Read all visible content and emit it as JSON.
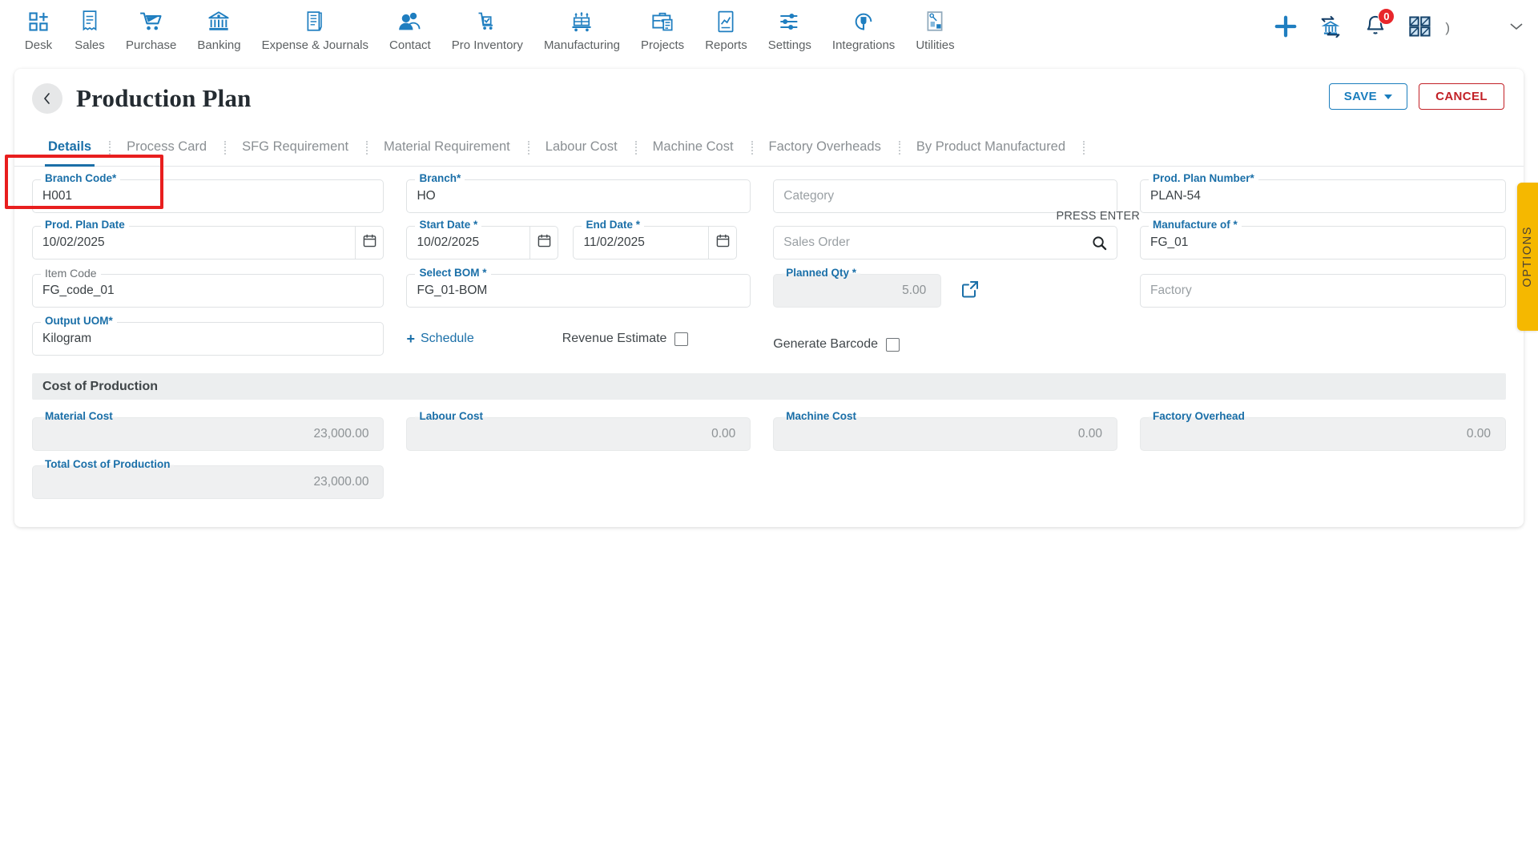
{
  "topnav": {
    "items": [
      {
        "label": "Desk",
        "icon": "desk-grid-plus-icon"
      },
      {
        "label": "Sales",
        "icon": "receipt-icon"
      },
      {
        "label": "Purchase",
        "icon": "shopping-cart-icon"
      },
      {
        "label": "Banking",
        "icon": "bank-icon"
      },
      {
        "label": "Expense & Journals",
        "icon": "notebook-pen-icon"
      },
      {
        "label": "Contact",
        "icon": "people-icon"
      },
      {
        "label": "Pro Inventory",
        "icon": "inventory-cart-icon"
      },
      {
        "label": "Manufacturing",
        "icon": "factory-pallet-icon"
      },
      {
        "label": "Projects",
        "icon": "briefcase-doc-icon"
      },
      {
        "label": "Reports",
        "icon": "report-chart-icon"
      },
      {
        "label": "Settings",
        "icon": "sliders-icon"
      },
      {
        "label": "Integrations",
        "icon": "plug-circle-icon"
      },
      {
        "label": "Utilities",
        "icon": "utilities-page-icon"
      }
    ],
    "right": {
      "add_icon": "plus-icon",
      "bank_transfer_icon": "bank-transfer-icon",
      "notifications_icon": "bell-icon",
      "notifications_count": "0",
      "apps_icon": "grid-apps-icon",
      "paren": ")",
      "expand_icon": "chevron-down-icon"
    }
  },
  "header": {
    "back_icon": "chevron-left-icon",
    "title": "Production Plan",
    "save_label": "SAVE",
    "cancel_label": "CANCEL"
  },
  "tabs": [
    {
      "label": "Details",
      "active": true
    },
    {
      "label": "Process Card",
      "active": false
    },
    {
      "label": "SFG Requirement",
      "active": false
    },
    {
      "label": "Material Requirement",
      "active": false
    },
    {
      "label": "Labour Cost",
      "active": false
    },
    {
      "label": "Machine Cost",
      "active": false
    },
    {
      "label": "Factory Overheads",
      "active": false
    },
    {
      "label": "By Product Manufactured",
      "active": false
    }
  ],
  "form": {
    "branch_code": {
      "label": "Branch Code",
      "required": "*",
      "value": "H001"
    },
    "branch": {
      "label": "Branch",
      "required": "*",
      "value": "HO"
    },
    "category": {
      "placeholder": "Category",
      "value": ""
    },
    "prod_plan_number": {
      "label": "Prod. Plan Number",
      "required": "*",
      "value": "PLAN-54"
    },
    "prod_plan_date": {
      "label": "Prod. Plan Date",
      "required": "",
      "value": "10/02/2025",
      "icon": "calendar-icon"
    },
    "start_date": {
      "label": "Start Date",
      "required": "*",
      "value": "10/02/2025",
      "icon": "calendar-icon"
    },
    "end_date": {
      "label": "End Date",
      "required": "*",
      "value": "11/02/2025",
      "icon": "calendar-icon"
    },
    "sales_order": {
      "placeholder": "Sales Order",
      "value": "",
      "hint": "PRESS ENTER",
      "icon": "search-icon"
    },
    "manufacture_of": {
      "label": "Manufacture of",
      "required": "*",
      "value": "FG_01"
    },
    "item_code": {
      "label": "Item Code",
      "required": "",
      "value": "FG_code_01",
      "highlighted": true
    },
    "select_bom": {
      "label": "Select BOM",
      "required": "*",
      "value": "FG_01-BOM"
    },
    "planned_qty": {
      "label": "Planned Qty",
      "required": "*",
      "value": "5.00",
      "disabled": true,
      "action_icon": "external-link-icon"
    },
    "factory": {
      "placeholder": "Factory",
      "value": ""
    },
    "output_uom": {
      "label": "Output UOM",
      "required": "*",
      "value": "Kilogram"
    },
    "schedule_link": {
      "label": "Schedule",
      "icon": "plus-icon"
    },
    "revenue_estimate": {
      "label": "Revenue Estimate",
      "checked": false
    },
    "generate_barcode": {
      "label": "Generate Barcode",
      "checked": false
    }
  },
  "cost_section": {
    "title": "Cost of Production",
    "material_cost": {
      "label": "Material Cost",
      "value": "23,000.00"
    },
    "labour_cost": {
      "label": "Labour Cost",
      "value": "0.00"
    },
    "machine_cost": {
      "label": "Machine Cost",
      "value": "0.00"
    },
    "factory_overhead": {
      "label": "Factory Overhead",
      "value": "0.00"
    },
    "total_cost": {
      "label": "Total Cost of Production",
      "value": "23,000.00"
    }
  },
  "side_panel": {
    "options_label": "OPTIONS"
  },
  "colors": {
    "accent_blue": "#1a6fa8",
    "icon_blue": "#1f7ec0",
    "danger_red": "#c22026",
    "annotation_red": "#e81e1e",
    "options_yellow": "#f5b800",
    "badge_red": "#e8262b"
  }
}
